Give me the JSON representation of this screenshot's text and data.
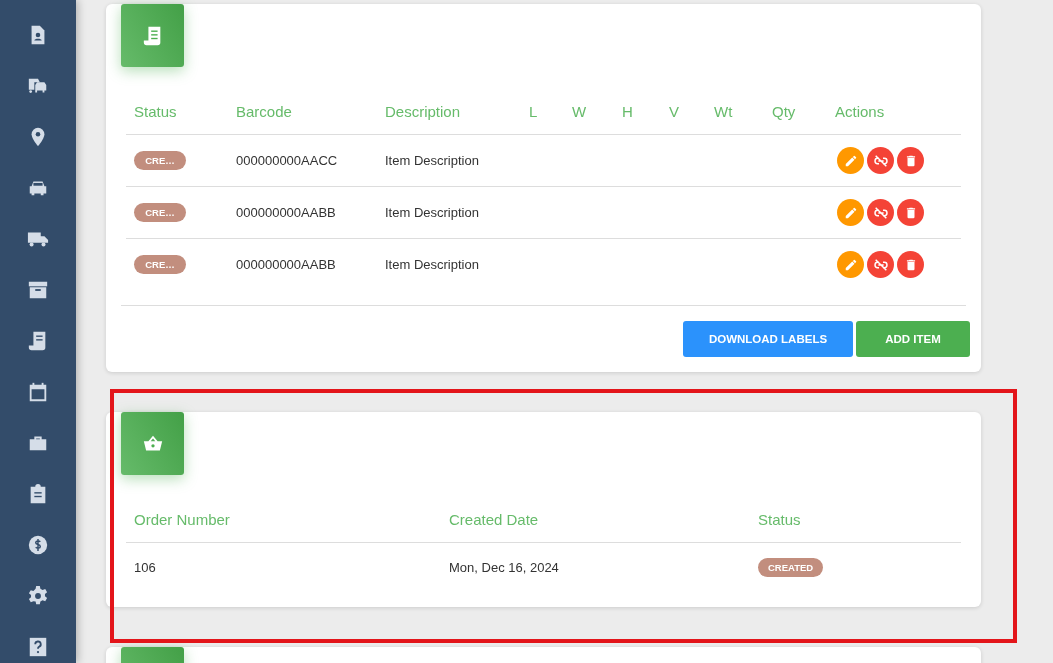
{
  "sidebar": {
    "items": [
      {
        "kind": "contact"
      },
      {
        "kind": "cars"
      },
      {
        "kind": "pin"
      },
      {
        "kind": "car"
      },
      {
        "kind": "truck"
      },
      {
        "kind": "archive"
      },
      {
        "kind": "receipt"
      },
      {
        "kind": "calendar"
      },
      {
        "kind": "briefcase"
      },
      {
        "kind": "clipboard"
      },
      {
        "kind": "dollar"
      },
      {
        "kind": "gear"
      },
      {
        "kind": "help"
      }
    ]
  },
  "items_card": {
    "kind": "receipt",
    "columns": [
      "Status",
      "Barcode",
      "Description",
      "L",
      "W",
      "H",
      "V",
      "Wt",
      "Qty",
      "Actions"
    ],
    "rows": [
      {
        "status": "CRE…",
        "barcode": "000000000AACC",
        "description": "Item Description"
      },
      {
        "status": "CRE…",
        "barcode": "000000000AABB",
        "description": "Item Description"
      },
      {
        "status": "CRE…",
        "barcode": "000000000AABB",
        "description": "Item Description"
      }
    ],
    "buttons": [
      {
        "label": "DOWNLOAD LABELS",
        "kind": "primary"
      },
      {
        "label": "ADD ITEM",
        "kind": "success"
      }
    ]
  },
  "order_card": {
    "kind": "basket",
    "columns": [
      "Order Number",
      "Created Date",
      "Status"
    ],
    "rows": [
      {
        "order_number": "106",
        "created_date": "Mon, Dec 16, 2024",
        "status": "CREATED"
      }
    ]
  }
}
